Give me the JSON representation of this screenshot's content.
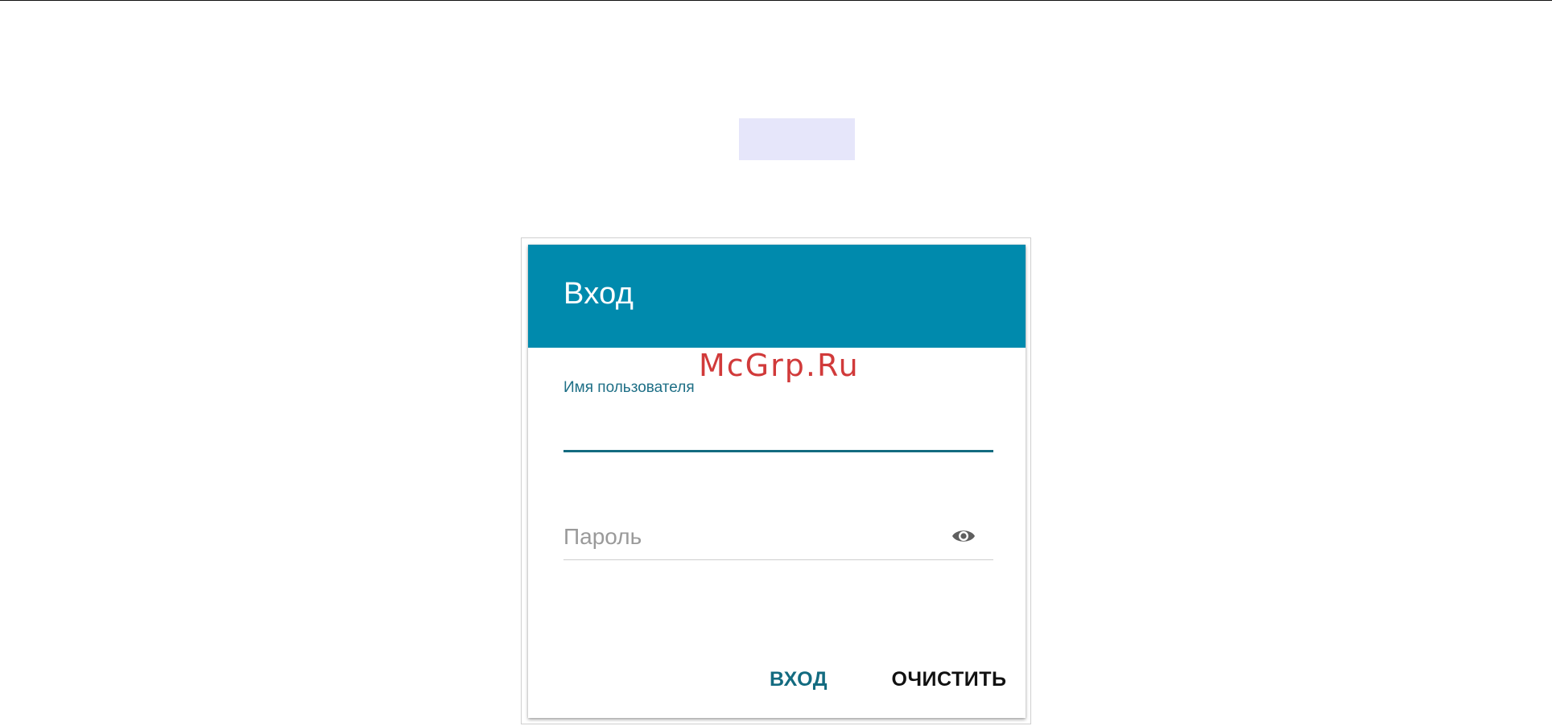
{
  "logo": {
    "placeholder_color": "#e6e6fa"
  },
  "login_dialog": {
    "title": "Вход",
    "header_color": "#008aad",
    "watermark": "McGrp.Ru",
    "username": {
      "label": "Имя пользователя",
      "value": ""
    },
    "password": {
      "placeholder": "Пароль",
      "value": "",
      "toggle_icon": "eye-icon"
    },
    "buttons": {
      "login_label": "ВХОД",
      "clear_label": "ОЧИСТИТЬ"
    }
  }
}
